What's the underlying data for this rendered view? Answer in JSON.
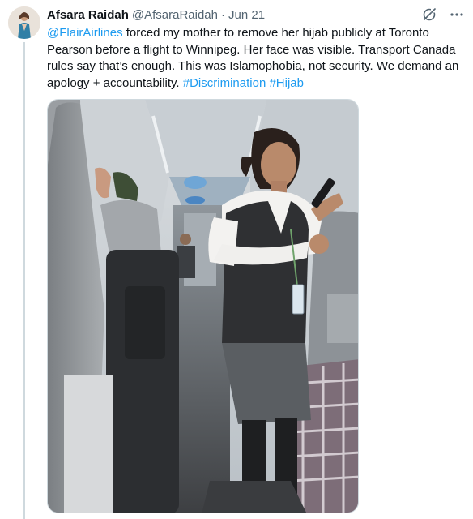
{
  "author": {
    "display_name": "Afsara Raidah",
    "handle": "@AfsaraRaidah",
    "separator": "·",
    "date": "Jun 21"
  },
  "icons": {
    "avatar": "avatar-image",
    "grok": "grok-icon",
    "more": "more-options-icon"
  },
  "tweet": {
    "mention": "@FlairAirlines",
    "text_1": " forced my mother to remove her hijab publicly at Toronto Pearson before a flight to Winnipeg. Her face was visible. Transport Canada rules say that’s enough. This was Islamophobia, not security. We demand an apology + accountability. ",
    "hashtag_1": "#Discrimination",
    "space": " ",
    "hashtag_2": "#Hijab"
  },
  "media": {
    "description_icon": "photo-attachment"
  },
  "colors": {
    "link": "#1d9bf0",
    "text": "#0f1419",
    "secondary": "#536471",
    "thread_line": "#cfd9de"
  }
}
